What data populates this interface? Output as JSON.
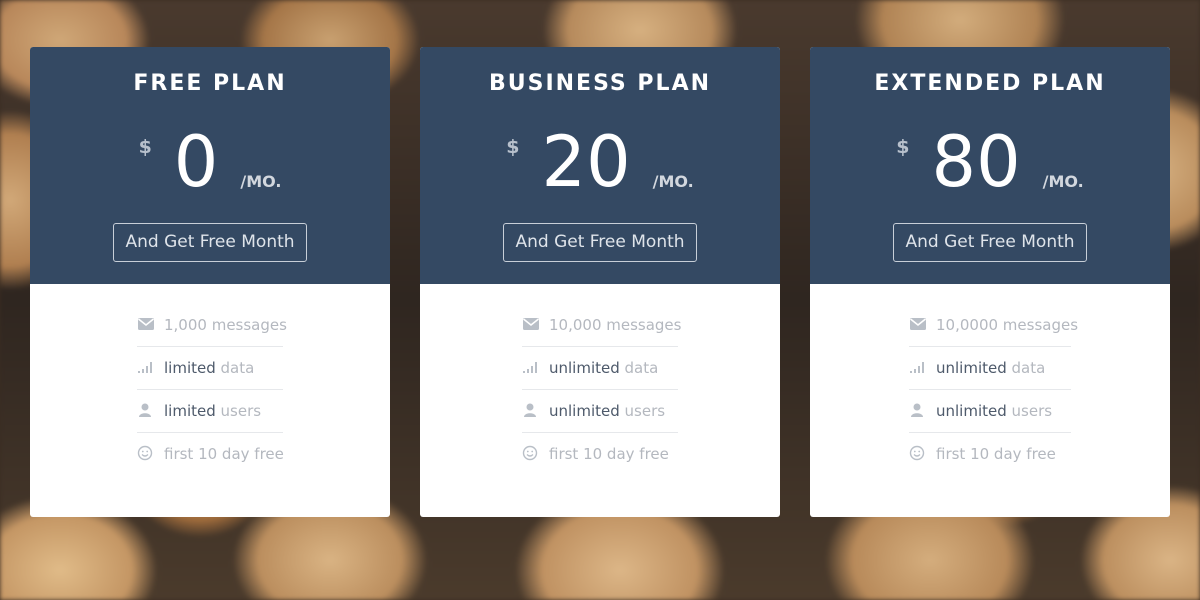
{
  "plans": [
    {
      "name": "FREE PLAN",
      "currency": "$",
      "amount": "0",
      "period": "/MO.",
      "cta": "And Get Free Month",
      "features": [
        {
          "icon": "envelope-icon",
          "highlight": "",
          "text": "1,000 messages"
        },
        {
          "icon": "signal-bars-icon",
          "highlight": "limited",
          "text": " data"
        },
        {
          "icon": "user-icon",
          "highlight": "limited",
          "text": " users"
        },
        {
          "icon": "smiley-icon",
          "highlight": "",
          "text": "first 10 day free"
        }
      ]
    },
    {
      "name": "BUSINESS PLAN",
      "currency": "$",
      "amount": "20",
      "period": "/MO.",
      "cta": "And Get Free Month",
      "features": [
        {
          "icon": "envelope-icon",
          "highlight": "",
          "text": "10,000 messages"
        },
        {
          "icon": "signal-bars-icon",
          "highlight": "unlimited",
          "text": " data"
        },
        {
          "icon": "user-icon",
          "highlight": "unlimited",
          "text": " users"
        },
        {
          "icon": "smiley-icon",
          "highlight": "",
          "text": "first 10 day free"
        }
      ]
    },
    {
      "name": "EXTENDED PLAN",
      "currency": "$",
      "amount": "80",
      "period": "/MO.",
      "cta": "And Get Free Month",
      "features": [
        {
          "icon": "envelope-icon",
          "highlight": "",
          "text": "10,0000 messages"
        },
        {
          "icon": "signal-bars-icon",
          "highlight": "unlimited",
          "text": " data"
        },
        {
          "icon": "user-icon",
          "highlight": "unlimited",
          "text": " users"
        },
        {
          "icon": "smiley-icon",
          "highlight": "",
          "text": "first 10 day free"
        }
      ]
    }
  ],
  "colors": {
    "header_bg": "#344963",
    "card_bg": "#ffffff",
    "muted_text": "#b4b8bf",
    "highlight_text": "#4e5a6b"
  }
}
